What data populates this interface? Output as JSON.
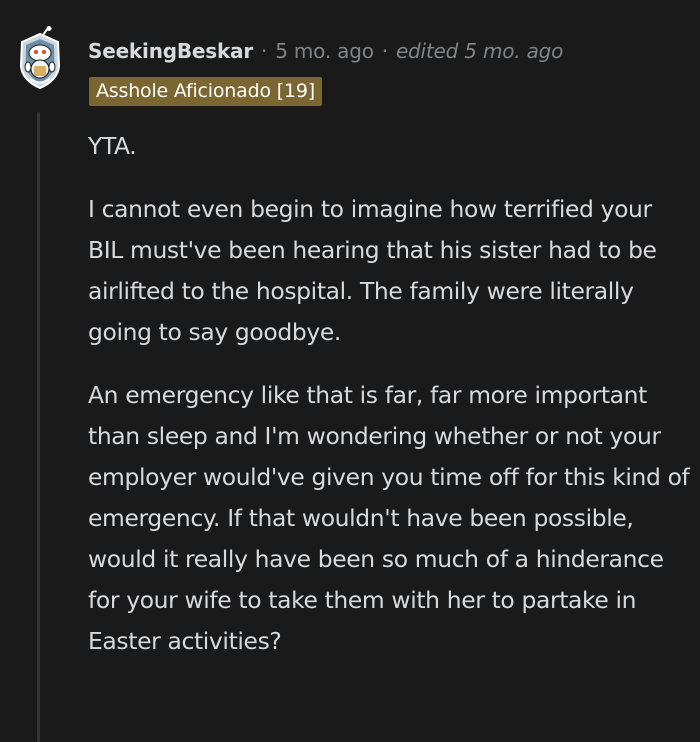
{
  "comment": {
    "username": "SeekingBeskar",
    "separator": "·",
    "time_ago": "5 mo. ago",
    "edited": "edited 5 mo. ago",
    "flair": "Asshole Aficionado [19]",
    "flair_color": "#7b6530",
    "avatar_icon": "snoo-avatar-icon",
    "paragraphs": [
      "YTA.",
      "I cannot even begin to imagine how terrified your BIL must've been hearing that his sister had to be airlifted to the hospital. The family were literally going to say goodbye.",
      "An emergency like that is far, far more important than sleep and I'm wondering whether or not your employer would've given you time off for this kind of emergency. If that wouldn't have been possible, would it really have been so much of a hinderance for your wife to take them with her to partake in Easter activities?"
    ]
  }
}
